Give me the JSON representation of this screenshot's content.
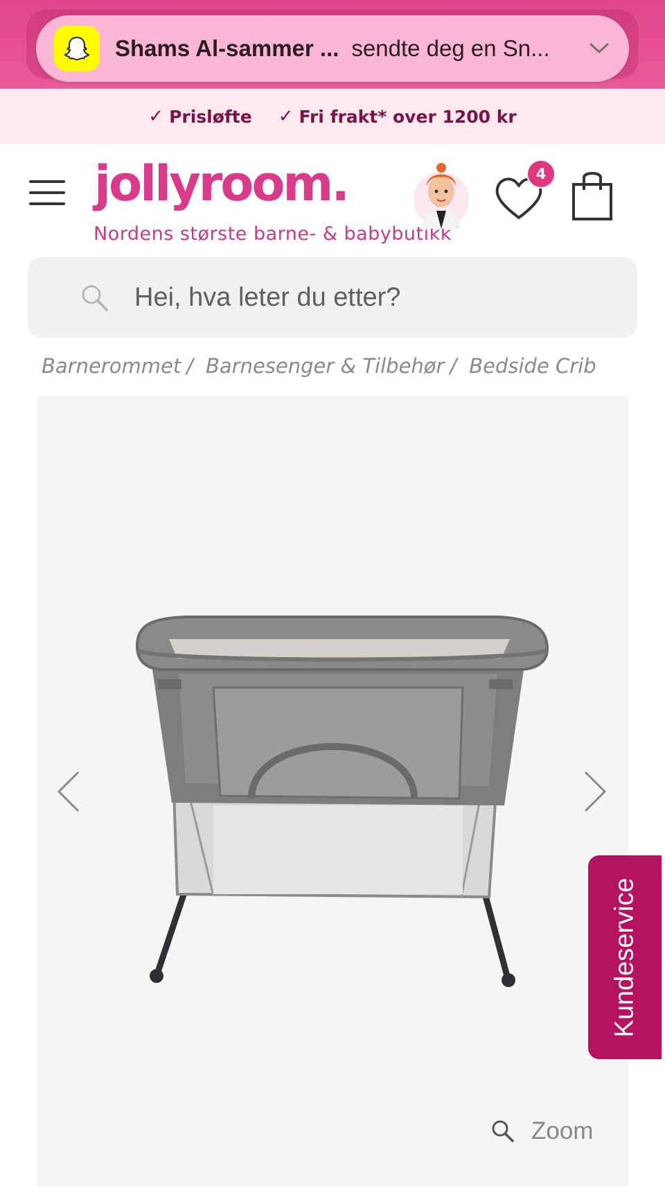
{
  "notification": {
    "app_icon": "snapchat-ghost-icon",
    "sender": "Shams Al-sammer ...",
    "message": "sendte deg en Sn...",
    "colors": {
      "banner_bg": "#e0468a",
      "pill_bg": "#f9b6d5",
      "icon_bg": "#fffc00"
    }
  },
  "usp": {
    "items": [
      {
        "label": "Prisløfte",
        "icon": "check-icon"
      },
      {
        "label": "Fri frakt* over 1200 kr",
        "icon": "check-icon"
      }
    ]
  },
  "header": {
    "menu_icon": "hamburger-menu-icon",
    "logo": "jollyroom.",
    "tagline": "Nordens største barne- & babybutikk",
    "wishlist_count": "4",
    "brand_color": "#d93b8a"
  },
  "search": {
    "placeholder": "Hei, hva leter du etter?"
  },
  "breadcrumb": {
    "items": [
      "Barnerommet",
      "Barnesenger & Tilbehør",
      "Bedside Crib"
    ],
    "separator": "/"
  },
  "gallery": {
    "zoom_label": "Zoom"
  },
  "customer_service": {
    "label": "Kundeservice",
    "color": "#b5135f"
  }
}
